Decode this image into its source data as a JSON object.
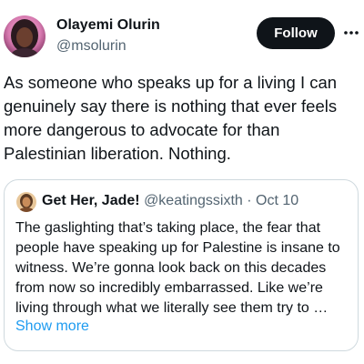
{
  "author": {
    "name": "Olayemi Olurin",
    "handle": "@msolurin",
    "avatar_icon": "profile-photo"
  },
  "follow_label": "Follow",
  "more_icon": "more-horizontal-icon",
  "text_lines": [
    "As someone who speaks up for a living I can",
    "genuinely say there is nothing that ever feels",
    "more dangerous to advocate for than",
    "Palestinian liberation. Nothing."
  ],
  "quoted": {
    "name": "Get Her, Jade!",
    "handle": "@keatingssixth",
    "separator": "·",
    "date": "Oct 10",
    "text_lines": [
      "The gaslighting that’s taking place, the fear that",
      "people have speaking up for Palestine is insane to",
      "witness. We’re gonna look back on this decades",
      "from now so incredibly embarrassed. Like we’re",
      "living through what we literally see them try to …"
    ],
    "show_more": "Show more"
  },
  "colors": {
    "text": "#0f1419",
    "secondary": "#536471",
    "link": "#1d9bf0",
    "border": "#cfd9de",
    "button_bg": "#0f1419"
  }
}
